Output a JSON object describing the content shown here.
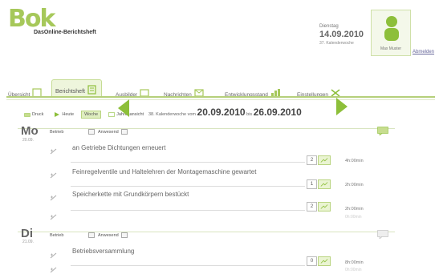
{
  "app": {
    "logo_text": "Bok",
    "title": "DasOnline-Berichtsheft"
  },
  "header": {
    "weekday": "Dienstag",
    "date": "14.09.2010",
    "calendar_week": "37. Kalenderwoche",
    "user_name": "Max Muster",
    "logout_label": "Abmelden"
  },
  "nav": {
    "tabs": [
      {
        "label": "Übersicht"
      },
      {
        "label": "Berichtsheft"
      },
      {
        "label": "Ausbilder"
      },
      {
        "label": "Nachrichten"
      },
      {
        "label": "Entwicklungsstand"
      },
      {
        "label": "Einstellungen"
      }
    ],
    "active_tab": "Berichtsheft"
  },
  "view_buttons": [
    {
      "label": "Druck"
    },
    {
      "label": "Heute"
    },
    {
      "label": "Woche"
    },
    {
      "label": "Jahresansicht"
    }
  ],
  "week": {
    "prefix": "38. Kalenderwoche vom",
    "from": "20.09.2010",
    "connector": "bis",
    "to": "26.09.2010"
  },
  "days": [
    {
      "name": "Mo",
      "date": "20.09.",
      "location": "Betrieb",
      "attendance": "Anwesend",
      "entries": [
        {
          "text": "an Getriebe Dichtungen erneuert",
          "hours": "2",
          "duration": "4h:00min"
        },
        {
          "text": "Feinregelventile und Haltelehren der Montagemaschine gewartet",
          "hours": "1",
          "duration": "2h:00min"
        },
        {
          "text": "Speicherkette mit Grundkörpern bestückt",
          "hours": "2",
          "duration": "2h:00min"
        }
      ],
      "extra_duration": "0h:00min"
    },
    {
      "name": "Di",
      "date": "21.09.",
      "location": "Betrieb",
      "attendance": "Anwesend",
      "entries": [
        {
          "text": "Betriebsversammlung",
          "hours": "0",
          "duration": "8h:00min"
        }
      ],
      "extra_duration": "0h:00min"
    }
  ],
  "colors": {
    "accent": "#8dbf3a",
    "accent_light": "#dfeec0"
  }
}
